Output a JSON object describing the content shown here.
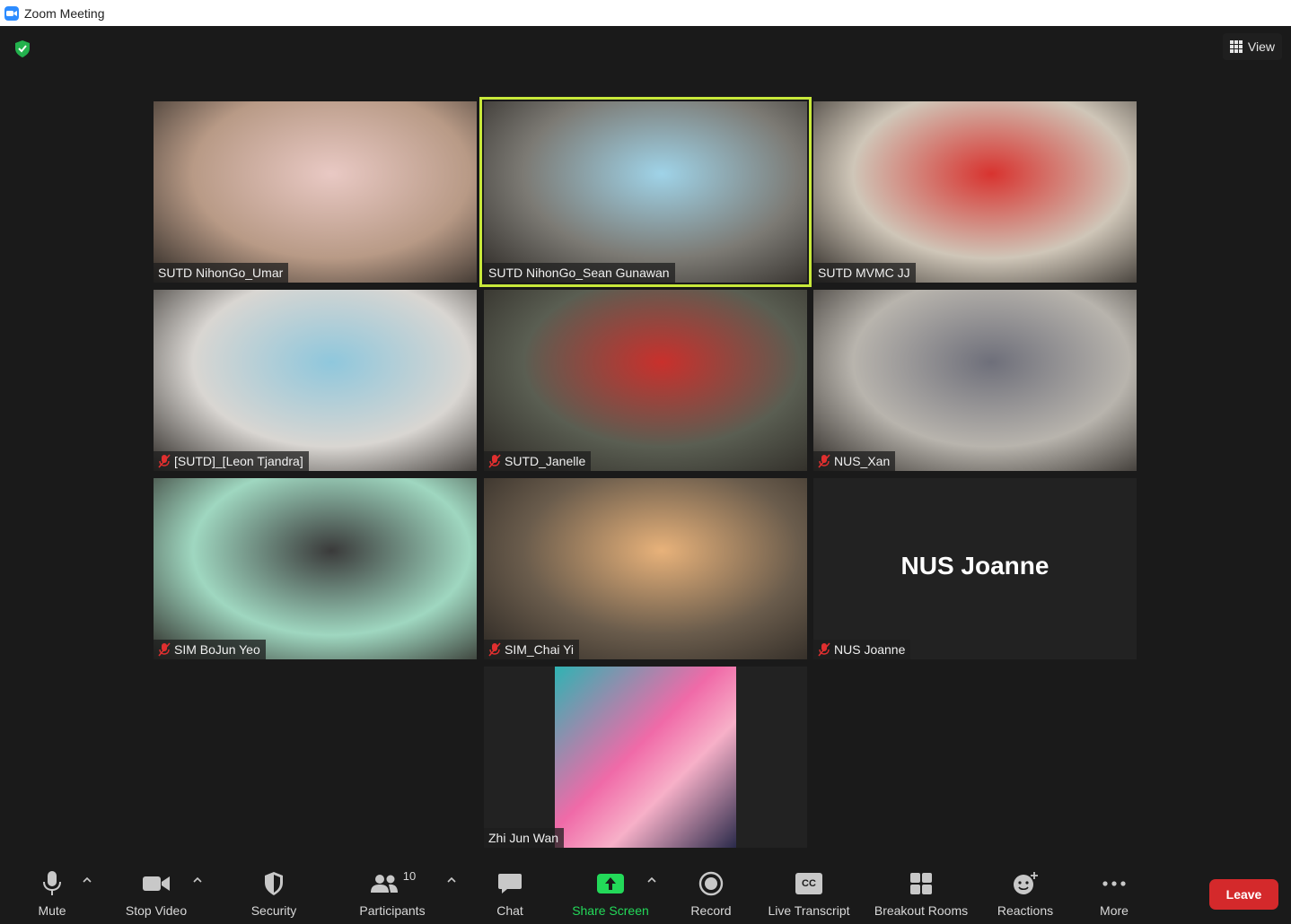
{
  "window": {
    "title": "Zoom Meeting"
  },
  "view_button": {
    "label": "View"
  },
  "participants": [
    {
      "name": "SUTD NihonGo_Umar",
      "muted": false,
      "bg": "#b89a86",
      "accent": "#e9c9c4"
    },
    {
      "name": "SUTD NihonGo_Sean Gunawan",
      "muted": false,
      "bg": "#7c7a74",
      "accent": "#9fd3e8",
      "active": true
    },
    {
      "name": "SUTD MVMC JJ",
      "muted": false,
      "bg": "#cfc6b8",
      "accent": "#d8332f"
    },
    {
      "name": "[SUTD]_[Leon Tjandra]",
      "muted": true,
      "bg": "#d9d6d2",
      "accent": "#8fc7dc"
    },
    {
      "name": "SUTD_Janelle",
      "muted": true,
      "bg": "#5a5e52",
      "accent": "#c9302c"
    },
    {
      "name": "NUS_Xan",
      "muted": true,
      "bg": "#b8b4ad",
      "accent": "#6e6f7a"
    },
    {
      "name": "SIM BoJun Yeo",
      "muted": true,
      "bg": "#9fd7c0",
      "accent": "#3a3a3a"
    },
    {
      "name": "SIM_Chai Yi",
      "muted": true,
      "bg": "#6a5c4c",
      "accent": "#e8b27a"
    },
    {
      "name": "NUS Joanne",
      "muted": true,
      "no_video": true,
      "center_name": "NUS Joanne"
    },
    {
      "name": "Zhi Jun Wan",
      "muted": false,
      "bg": "#222222",
      "accent": "#f06aa8",
      "avatar": true
    }
  ],
  "toolbar": {
    "mute": "Mute",
    "stop_video": "Stop Video",
    "security": "Security",
    "participants": "Participants",
    "participant_count": "10",
    "chat": "Chat",
    "share_screen": "Share Screen",
    "record": "Record",
    "live_transcript": "Live Transcript",
    "breakout_rooms": "Breakout Rooms",
    "reactions": "Reactions",
    "more": "More",
    "leave": "Leave",
    "cc_text": "CC"
  },
  "colors": {
    "share_green": "#23d959",
    "leave_red": "#d4292b",
    "active_border": "#c8e83a"
  }
}
